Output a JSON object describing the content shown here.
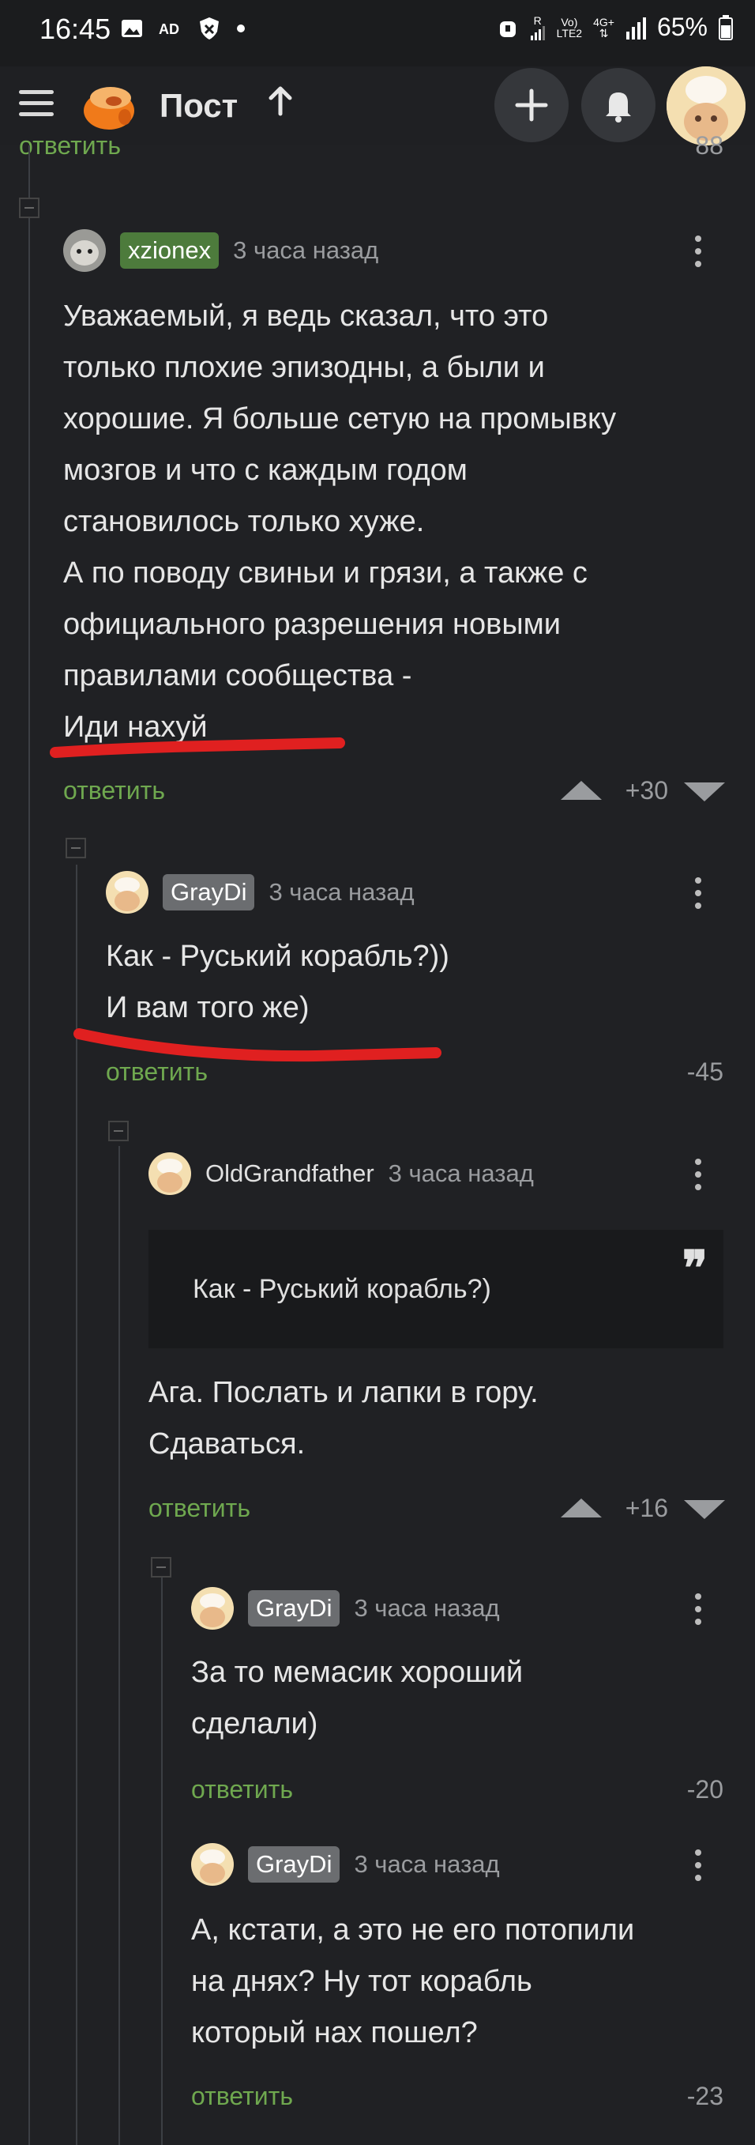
{
  "status_bar": {
    "time": "16:45",
    "battery": "65%",
    "net_r": "R",
    "net_volte": "Vo)",
    "net_lte": "LTE2",
    "net_4g": "4G+"
  },
  "app_bar": {
    "title": "Пост",
    "icons": [
      "menu-icon",
      "logo-icon",
      "arrow-up-icon",
      "plus-icon",
      "bell-icon",
      "avatar"
    ]
  },
  "top_partial": {
    "reply": "ответить",
    "rating": "88"
  },
  "comments": [
    {
      "author": "xzionex",
      "time": "3 часа назад",
      "text": "Уважаемый, я ведь сказал, что это\nтолько плохие эпизодны, а были и\nхорошие. Я больше сетую на промывку\nмозгов и что с каждым годом\nстановилось только хуже.\nА по поводу свиньи и грязи, а также с\nофициального разрешения новыми\nправилами сообщества -\nИди нахуй",
      "reply": "ответить",
      "rating": "+30"
    },
    {
      "author": "GrayDi",
      "time": "3 часа назад",
      "text": "Как - Руський корабль?))\nИ вам того же)",
      "reply": "ответить",
      "rating": "-45"
    },
    {
      "author": "OldGrandfather",
      "time": "3 часа назад",
      "quote": "Как - Руський корабль?)",
      "text": "Ага. Послать и лапки в гору.\nСдаваться.",
      "reply": "ответить",
      "rating": "+16"
    },
    {
      "author": "GrayDi",
      "time": "3 часа назад",
      "text": "За то мемасик хороший\nсделали)",
      "reply": "ответить",
      "rating": "-20"
    },
    {
      "author": "GrayDi",
      "time": "3 часа назад",
      "text": "А, кстати, а это не его потопили\nна днях? Ну тот корабль\nкоторый нах пошел?",
      "reply": "ответить",
      "rating": "-23"
    }
  ],
  "colors": {
    "background": "#202124",
    "reply_green": "#6fa84f",
    "badge_green": "#4d7b3c",
    "badge_gray": "#6b6d70",
    "annotation_red": "#e02020"
  }
}
